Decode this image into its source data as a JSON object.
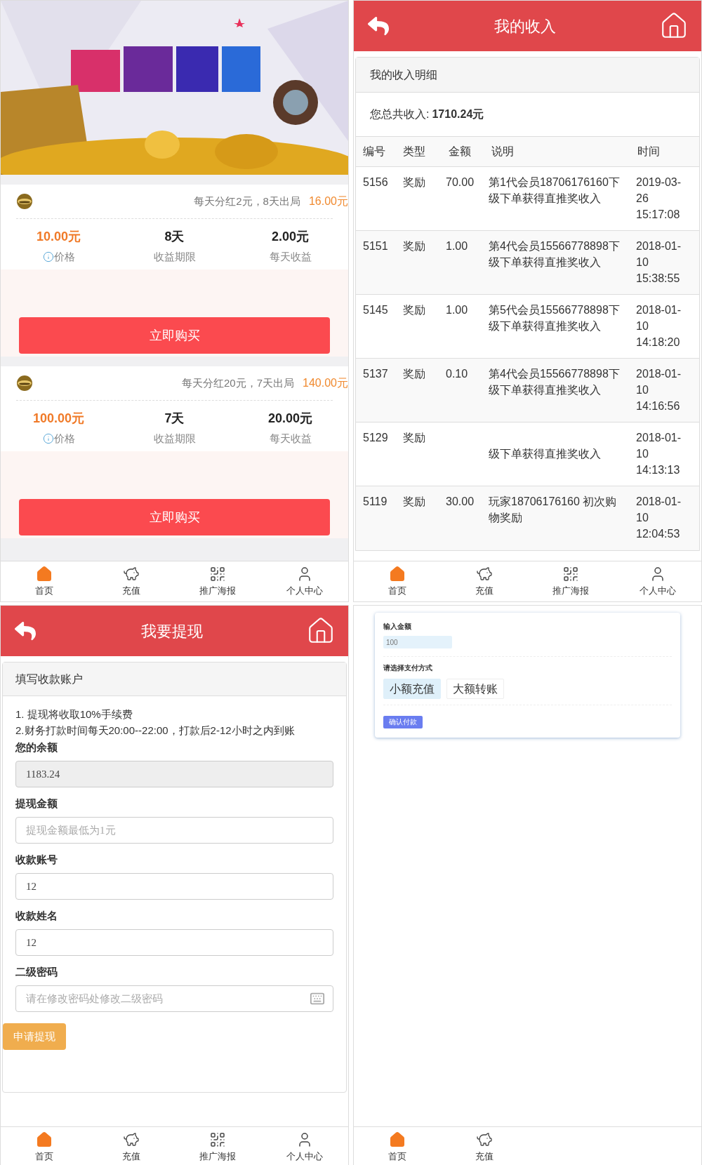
{
  "product_screen": {
    "products": [
      {
        "summary": "每天分红2元，8天出局",
        "total": "16.00元",
        "price": "10.00元",
        "price_label": "价格",
        "term": "8天",
        "term_label": "收益期限",
        "daily": "2.00元",
        "daily_label": "每天收益",
        "button": "立即购买"
      },
      {
        "summary": "每天分红20元，7天出局",
        "total": "140.00元",
        "price": "100.00元",
        "price_label": "价格",
        "term": "7天",
        "term_label": "收益期限",
        "daily": "20.00元",
        "daily_label": "每天收益",
        "button": "立即购买"
      }
    ],
    "tab_bar": [
      {
        "label": "首页",
        "kind": "home",
        "selected": true
      },
      {
        "label": "充值",
        "kind": "piggy",
        "selected": false
      },
      {
        "label": "推广海报",
        "kind": "qr",
        "selected": false
      },
      {
        "label": "个人中心",
        "kind": "user",
        "selected": false
      }
    ]
  },
  "income_screen": {
    "title": "我的收入",
    "panel_title": "我的收入明细",
    "total_label": "您总共收入:",
    "total_value": "1710.24元",
    "columns": [
      "编号",
      "类型",
      "金额",
      "说明",
      "时间"
    ],
    "rows": [
      {
        "id": "5156",
        "type": "奖励",
        "amount": "70.00",
        "description": "第1代会员18706176160下级下单获得直推奖收入",
        "time": "2019-03-26 15:17:08"
      },
      {
        "id": "5151",
        "type": "奖励",
        "amount": "1.00",
        "description": "第4代会员15566778898下级下单获得直推奖收入",
        "time": "2018-01-10 15:38:55"
      },
      {
        "id": "5145",
        "type": "奖励",
        "amount": "1.00",
        "description": "第5代会员15566778898下级下单获得直推奖收入",
        "time": "2018-01-10 14:18:20"
      },
      {
        "id": "5137",
        "type": "奖励",
        "amount": "0.10",
        "description": "第4代会员15566778898下级下单获得直推奖收入",
        "time": "2018-01-10 14:16:56"
      },
      {
        "id": "5129",
        "type": "奖励",
        "description": "级下单获得直推奖收入",
        "first_line_hidden": true,
        "time": "2018-01-10 14:13:13"
      },
      {
        "id": "5119",
        "type": "奖励",
        "amount": "30.00",
        "description": "玩家18706176160 初次购物奖励",
        "time": "2018-01-10 12:04:53"
      }
    ],
    "tab_bar": [
      {
        "label": "首页",
        "kind": "home",
        "selected": true
      },
      {
        "label": "充值",
        "kind": "piggy",
        "selected": false
      },
      {
        "label": "推广海报",
        "kind": "qr",
        "selected": false
      },
      {
        "label": "个人中心",
        "kind": "user",
        "selected": false
      }
    ]
  },
  "withdraw_screen": {
    "title": "我要提现",
    "panel_title": "填写收款账户",
    "notes": [
      "1. 提现将收取10%手续费",
      "2.财务打款时间每天20:00--22:00，打款后2-12小时之内到账"
    ],
    "fields": [
      {
        "label": "您的余额",
        "value": "1183.24",
        "readonly": true
      },
      {
        "label": "提现金额",
        "placeholder": "提现金额最低为1元",
        "readonly": false
      },
      {
        "label": "收款账号",
        "value": "12",
        "readonly": false
      },
      {
        "label": "收款姓名",
        "value": "12",
        "readonly": false
      },
      {
        "label": "二级密码",
        "placeholder": "请在修改密码处修改二级密码",
        "readonly": false,
        "keyboard": true
      }
    ],
    "submit": "申请提现",
    "tab_bar": [
      {
        "label": "首页",
        "kind": "home",
        "selected": true
      },
      {
        "label": "充值",
        "kind": "piggy",
        "selected": false
      },
      {
        "label": "推广海报",
        "kind": "qr",
        "selected": false
      },
      {
        "label": "个人中心",
        "kind": "user",
        "selected": false
      }
    ]
  },
  "recharge_screen": {
    "amount_label": "输入金额",
    "amount_value": "100",
    "method_label": "请选择支付方式",
    "methods": [
      {
        "label": "小额充值",
        "selected": true
      },
      {
        "label": "大额转账",
        "selected": false
      }
    ],
    "confirm": "确认付款",
    "tab_bar": [
      {
        "label": "首页",
        "kind": "home",
        "selected": true
      },
      {
        "label": "充值",
        "kind": "piggy",
        "selected": false
      }
    ]
  }
}
